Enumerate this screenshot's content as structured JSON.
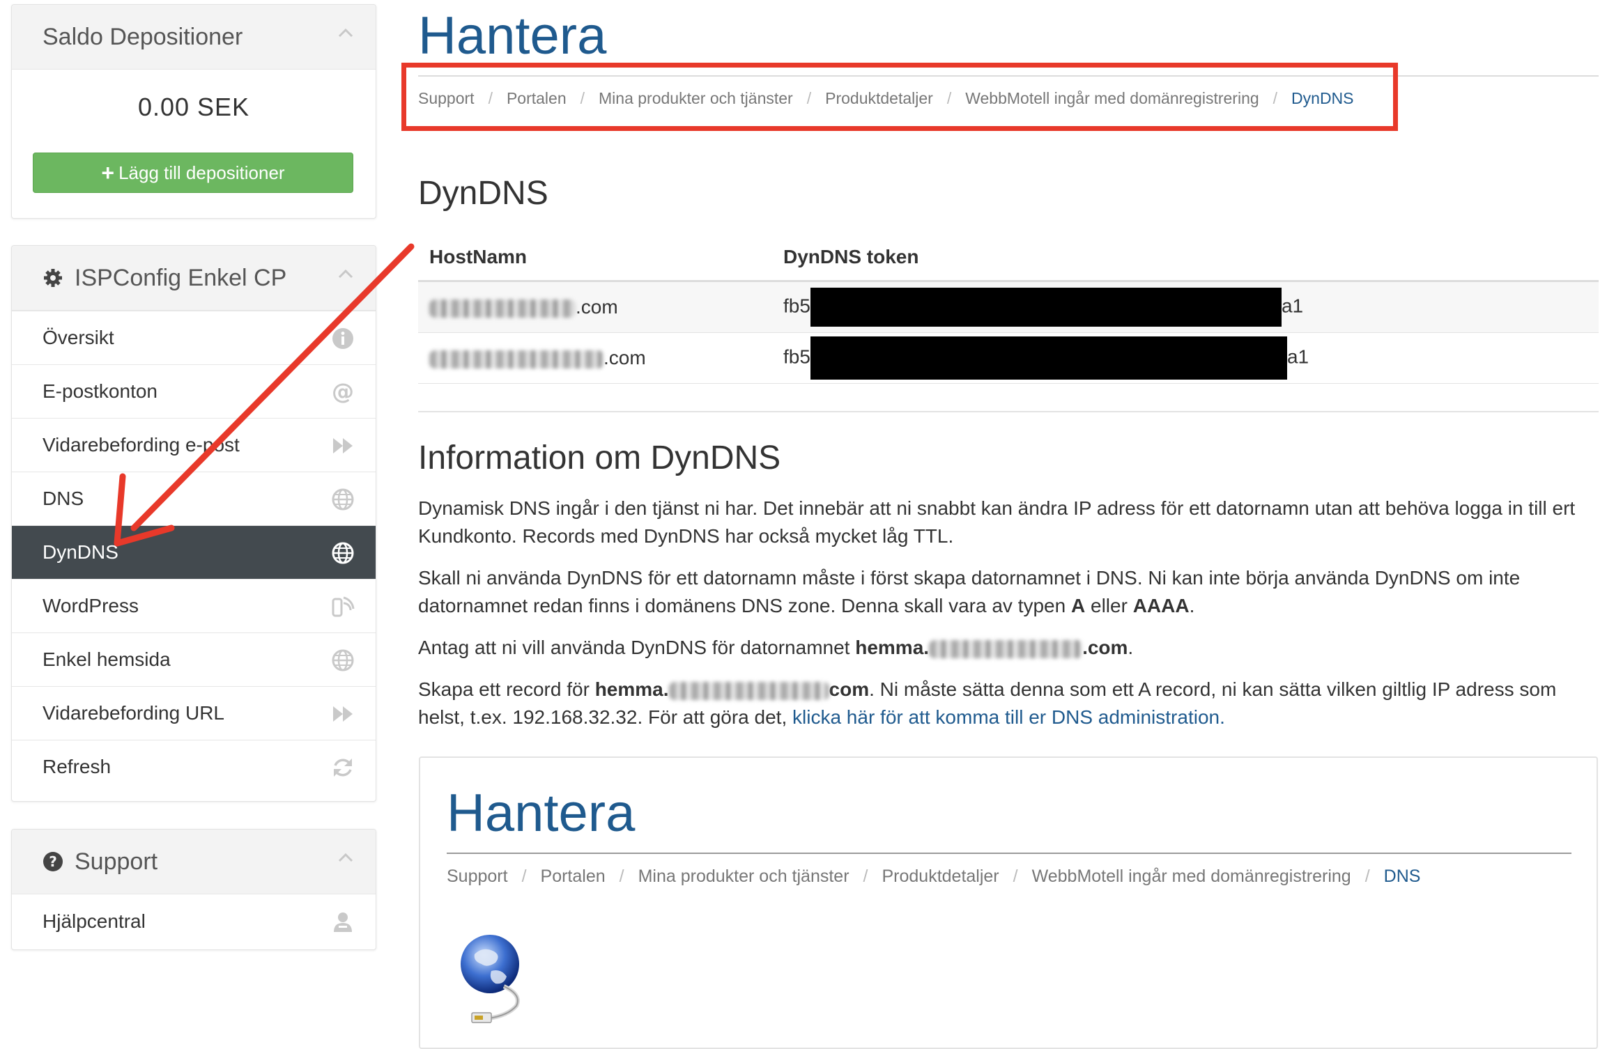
{
  "balance_panel": {
    "title": "Saldo Depositioner",
    "amount": "0.00 SEK",
    "add_button": "Lägg till depositioner"
  },
  "ispconfig_panel": {
    "title": "ISPConfig Enkel CP",
    "items": [
      {
        "label": "Översikt",
        "icon": "info-icon"
      },
      {
        "label": "E-postkonton",
        "icon": "at-icon"
      },
      {
        "label": "Vidarebefording e-post",
        "icon": "forward-icon"
      },
      {
        "label": "DNS",
        "icon": "globe-icon"
      },
      {
        "label": "DynDNS",
        "icon": "globe-icon",
        "active": true
      },
      {
        "label": "WordPress",
        "icon": "wordpress-icon"
      },
      {
        "label": "Enkel hemsida",
        "icon": "globe-icon"
      },
      {
        "label": "Vidarebefording URL",
        "icon": "forward-icon"
      },
      {
        "label": "Refresh",
        "icon": "refresh-icon"
      }
    ]
  },
  "support_panel": {
    "title": "Support",
    "items": [
      {
        "label": "Hjälpcentral",
        "icon": "support-agent-icon"
      }
    ]
  },
  "header": {
    "title": "Hantera",
    "breadcrumbs": [
      "Support",
      "Portalen",
      "Mina produkter och tjänster",
      "Produktdetaljer",
      "WebbMotell ingår med domänregistrering",
      "DynDNS"
    ]
  },
  "dyndns": {
    "heading": "DynDNS",
    "columns": [
      "HostNamn",
      "DynDNS token"
    ],
    "rows": [
      {
        "host_suffix": ".com",
        "token_prefix": "fb5",
        "token_suffix": "a1"
      },
      {
        "host_suffix": ".com",
        "token_prefix": "fb5",
        "token_suffix": "a1"
      }
    ]
  },
  "info": {
    "heading": "Information om DynDNS",
    "p1": "Dynamisk DNS ingår i den tjänst ni har. Det innebär att ni snabbt kan ändra IP adress för ett datornamn utan att behöva logga in till ert Kundkonto. Records med DynDNS har också mycket låg TTL.",
    "p2_a": "Skall ni använda DynDNS för ett datornamn måste i först skapa datornamnet i DNS. Ni kan inte börja använda DynDNS om inte datornamnet redan finns i domänens DNS zone. Denna skall vara av typen ",
    "p2_b1": "A",
    "p2_mid": " eller ",
    "p2_b2": "AAAA",
    "p2_end": ".",
    "p3_a": "Antag att ni vill använda DynDNS för datornamnet ",
    "p3_b": "hemma.",
    "p3_c": ".com",
    "p3_end": ".",
    "p4_a": "Skapa ett record för ",
    "p4_b": "hemma.",
    "p4_c": "com",
    "p4_d": ". Ni måste sätta denna som ett A record, ni kan sätta vilken giltlig IP adress som helst, t.ex. 192.168.32.32. För att göra det, ",
    "p4_link": "klicka här för att komma till er DNS administration."
  },
  "embed": {
    "title": "Hantera",
    "breadcrumbs": [
      "Support",
      "Portalen",
      "Mina produkter och tjänster",
      "Produktdetaljer",
      "WebbMotell ingår med domänregistrering",
      "DNS"
    ],
    "image_icon": "network-globe-icon"
  },
  "colors": {
    "accent": "#1f5a8e",
    "active_item": "#434a4f",
    "add_button": "#6cb760",
    "annotation": "#e8392a"
  }
}
